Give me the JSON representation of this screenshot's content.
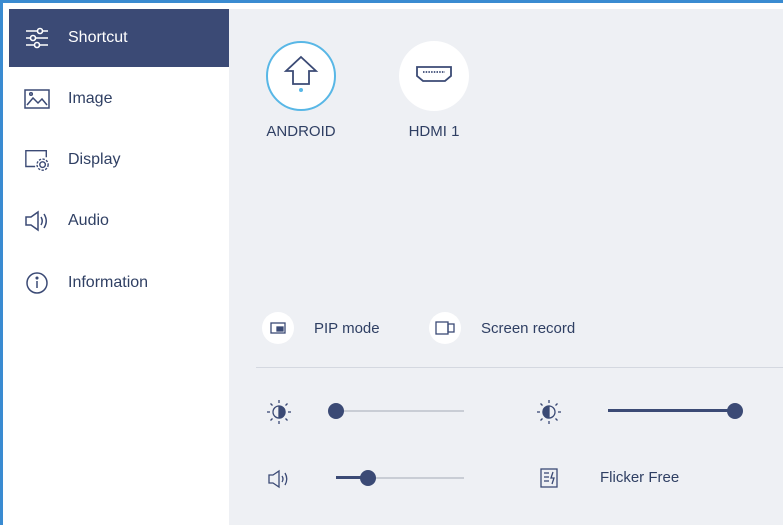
{
  "sidebar": {
    "items": [
      {
        "label": "Shortcut",
        "icon": "sliders-icon",
        "active": true
      },
      {
        "label": "Image",
        "icon": "image-icon"
      },
      {
        "label": "Display",
        "icon": "display-settings-icon"
      },
      {
        "label": "Audio",
        "icon": "speaker-icon"
      },
      {
        "label": "Information",
        "icon": "info-icon"
      }
    ]
  },
  "sources": [
    {
      "label": "ANDROID",
      "icon": "home-icon",
      "selected": true
    },
    {
      "label": "HDMI 1",
      "icon": "hdmi-icon"
    }
  ],
  "quick_actions": [
    {
      "label": "PIP mode",
      "icon": "pip-icon"
    },
    {
      "label": "Screen record",
      "icon": "screen-record-icon"
    }
  ],
  "controls": {
    "brightness": {
      "icon": "brightness-icon",
      "level": 0.0
    },
    "contrast": {
      "icon": "contrast-icon",
      "level": 1.0
    },
    "volume": {
      "icon": "volume-icon",
      "level": 0.25
    },
    "flicker_free": {
      "icon": "flicker-free-icon",
      "label": "Flicker Free"
    }
  },
  "colors": {
    "accent": "#3a8bd1",
    "active_bg": "#3b4a75",
    "selected_ring": "#58b7e6",
    "panel_bg": "#eef0f4"
  }
}
